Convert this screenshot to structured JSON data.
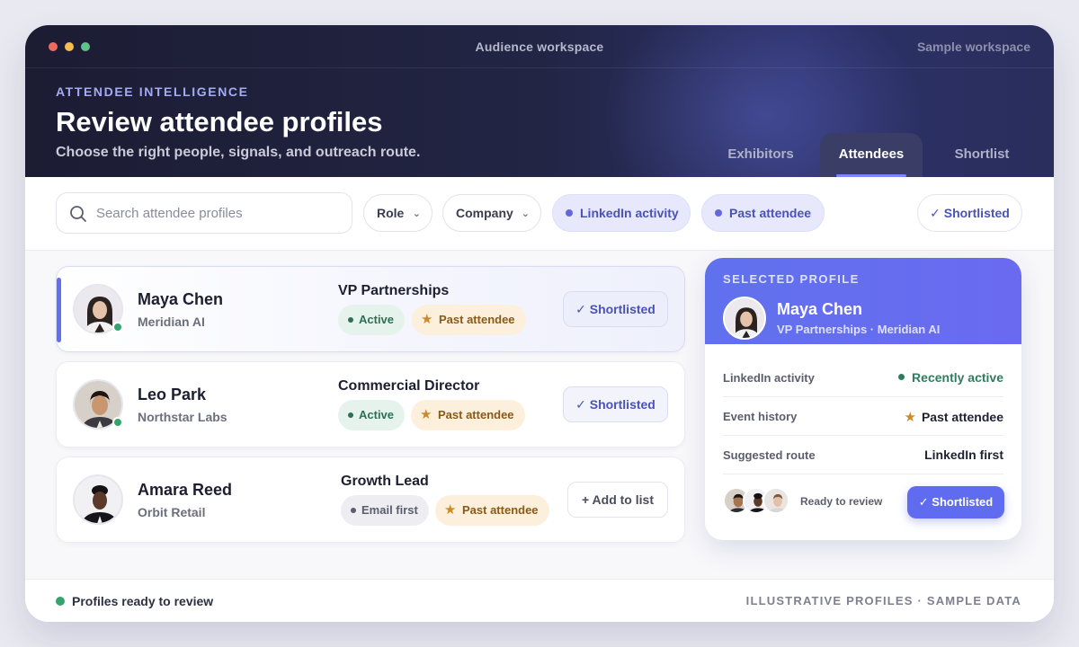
{
  "window": {
    "title": "Audience workspace",
    "workspace_label": "Sample workspace"
  },
  "header": {
    "eyebrow": "ATTENDEE INTELLIGENCE",
    "title": "Review attendee profiles",
    "subtitle": "Choose the right people, signals, and outreach route.",
    "tabs": [
      {
        "label": "Exhibitors",
        "active": false
      },
      {
        "label": "Attendees",
        "active": true
      },
      {
        "label": "Shortlist",
        "active": false
      }
    ]
  },
  "filters": {
    "search_placeholder": "Search attendee profiles",
    "role": "Role",
    "company": "Company",
    "linkedin": "LinkedIn activity",
    "past": "Past attendee",
    "shortlisted": "✓ Shortlisted"
  },
  "profiles": [
    {
      "name": "Maya Chen",
      "company": "Meridian AI",
      "role": "VP Partnerships",
      "badge1": "Active",
      "badge2": "Past attendee",
      "action": "✓ Shortlisted",
      "selected": true
    },
    {
      "name": "Leo Park",
      "company": "Northstar Labs",
      "role": "Commercial Director",
      "badge1": "Active",
      "badge2": "Past attendee",
      "action": "✓ Shortlisted",
      "selected": false
    },
    {
      "name": "Amara Reed",
      "company": "Orbit Retail",
      "role": "Growth Lead",
      "badge1": "Email first",
      "badge2": "Past attendee",
      "action": "+ Add to list",
      "selected": false
    }
  ],
  "panel": {
    "eyebrow": "SELECTED PROFILE",
    "name": "Maya Chen",
    "subtitle": "VP Partnerships · Meridian AI",
    "rows": [
      {
        "label": "LinkedIn activity",
        "value": "Recently active"
      },
      {
        "label": "Event history",
        "value": "Past attendee"
      },
      {
        "label": "Suggested route",
        "value": "LinkedIn first"
      }
    ],
    "ready_text": "Ready to review",
    "button": "✓ Shortlisted"
  },
  "footer": {
    "left": "Profiles ready to review",
    "right": "ILLUSTRATIVE PROFILES · SAMPLE DATA"
  },
  "colors": {
    "accent": "#5f6cf0",
    "header_bg": "#1c1c33",
    "active_green": "#35a46c",
    "past_orange": "#cc8a27"
  },
  "icons": {
    "search": "search-icon",
    "star": "star-icon",
    "chevron": "chevron-down-icon"
  }
}
